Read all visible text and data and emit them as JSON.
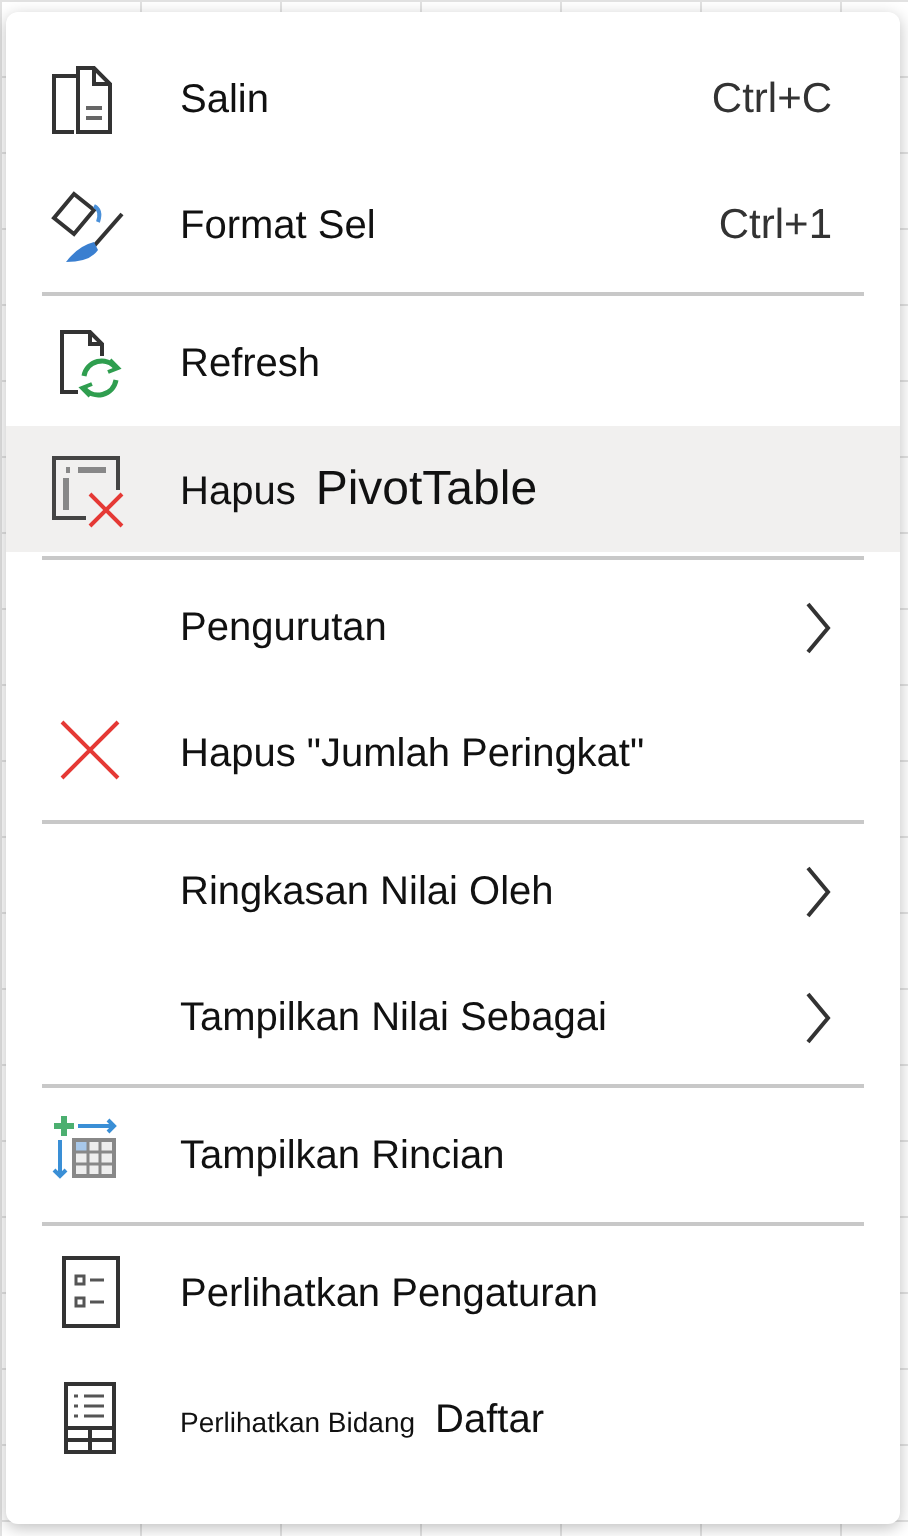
{
  "menu": {
    "sections": [
      {
        "items": [
          {
            "kind": "copy",
            "label": [
              {
                "kind": "normal",
                "text": "Salin"
              }
            ],
            "shortcut": "Ctrl+C",
            "submenu": false,
            "selected": false
          },
          {
            "kind": "format",
            "label": [
              {
                "kind": "normal",
                "text": "Format Sel"
              }
            ],
            "shortcut": "Ctrl+1",
            "submenu": false,
            "selected": false
          }
        ]
      },
      {
        "items": [
          {
            "kind": "refresh",
            "label": [
              {
                "kind": "normal",
                "text": "Refresh"
              }
            ],
            "submenu": false,
            "selected": false
          },
          {
            "kind": "delete-table",
            "label": [
              {
                "kind": "normal",
                "text": "Hapus"
              },
              {
                "kind": "large",
                "text": "PivotTable"
              }
            ],
            "submenu": false,
            "selected": true
          }
        ]
      },
      {
        "items": [
          {
            "kind": "plain",
            "label": [
              {
                "kind": "normal",
                "text": "Pengurutan"
              }
            ],
            "submenu": true,
            "selected": false
          },
          {
            "kind": "remove",
            "label": [
              {
                "kind": "normal",
                "text": "Hapus \"Jumlah Peringkat\""
              }
            ],
            "submenu": false,
            "selected": false
          }
        ]
      },
      {
        "items": [
          {
            "kind": "plain",
            "label": [
              {
                "kind": "normal",
                "text": "Ringkasan Nilai Oleh"
              }
            ],
            "submenu": true,
            "selected": false
          },
          {
            "kind": "plain",
            "label": [
              {
                "kind": "normal",
                "text": "Tampilkan Nilai Sebagai"
              }
            ],
            "submenu": true,
            "selected": false
          }
        ]
      },
      {
        "items": [
          {
            "kind": "details",
            "label": [
              {
                "kind": "normal",
                "text": "Tampilkan Rincian"
              }
            ],
            "submenu": false,
            "selected": false
          }
        ]
      },
      {
        "items": [
          {
            "kind": "settings",
            "label": [
              {
                "kind": "normal",
                "text": "Perlihatkan Pengaturan"
              }
            ],
            "submenu": false,
            "selected": false
          },
          {
            "kind": "field-list",
            "label": [
              {
                "kind": "small",
                "text": "Perlihatkan Bidang"
              },
              {
                "kind": "normal",
                "text": "Daftar"
              }
            ],
            "submenu": false,
            "selected": false
          }
        ]
      }
    ]
  }
}
